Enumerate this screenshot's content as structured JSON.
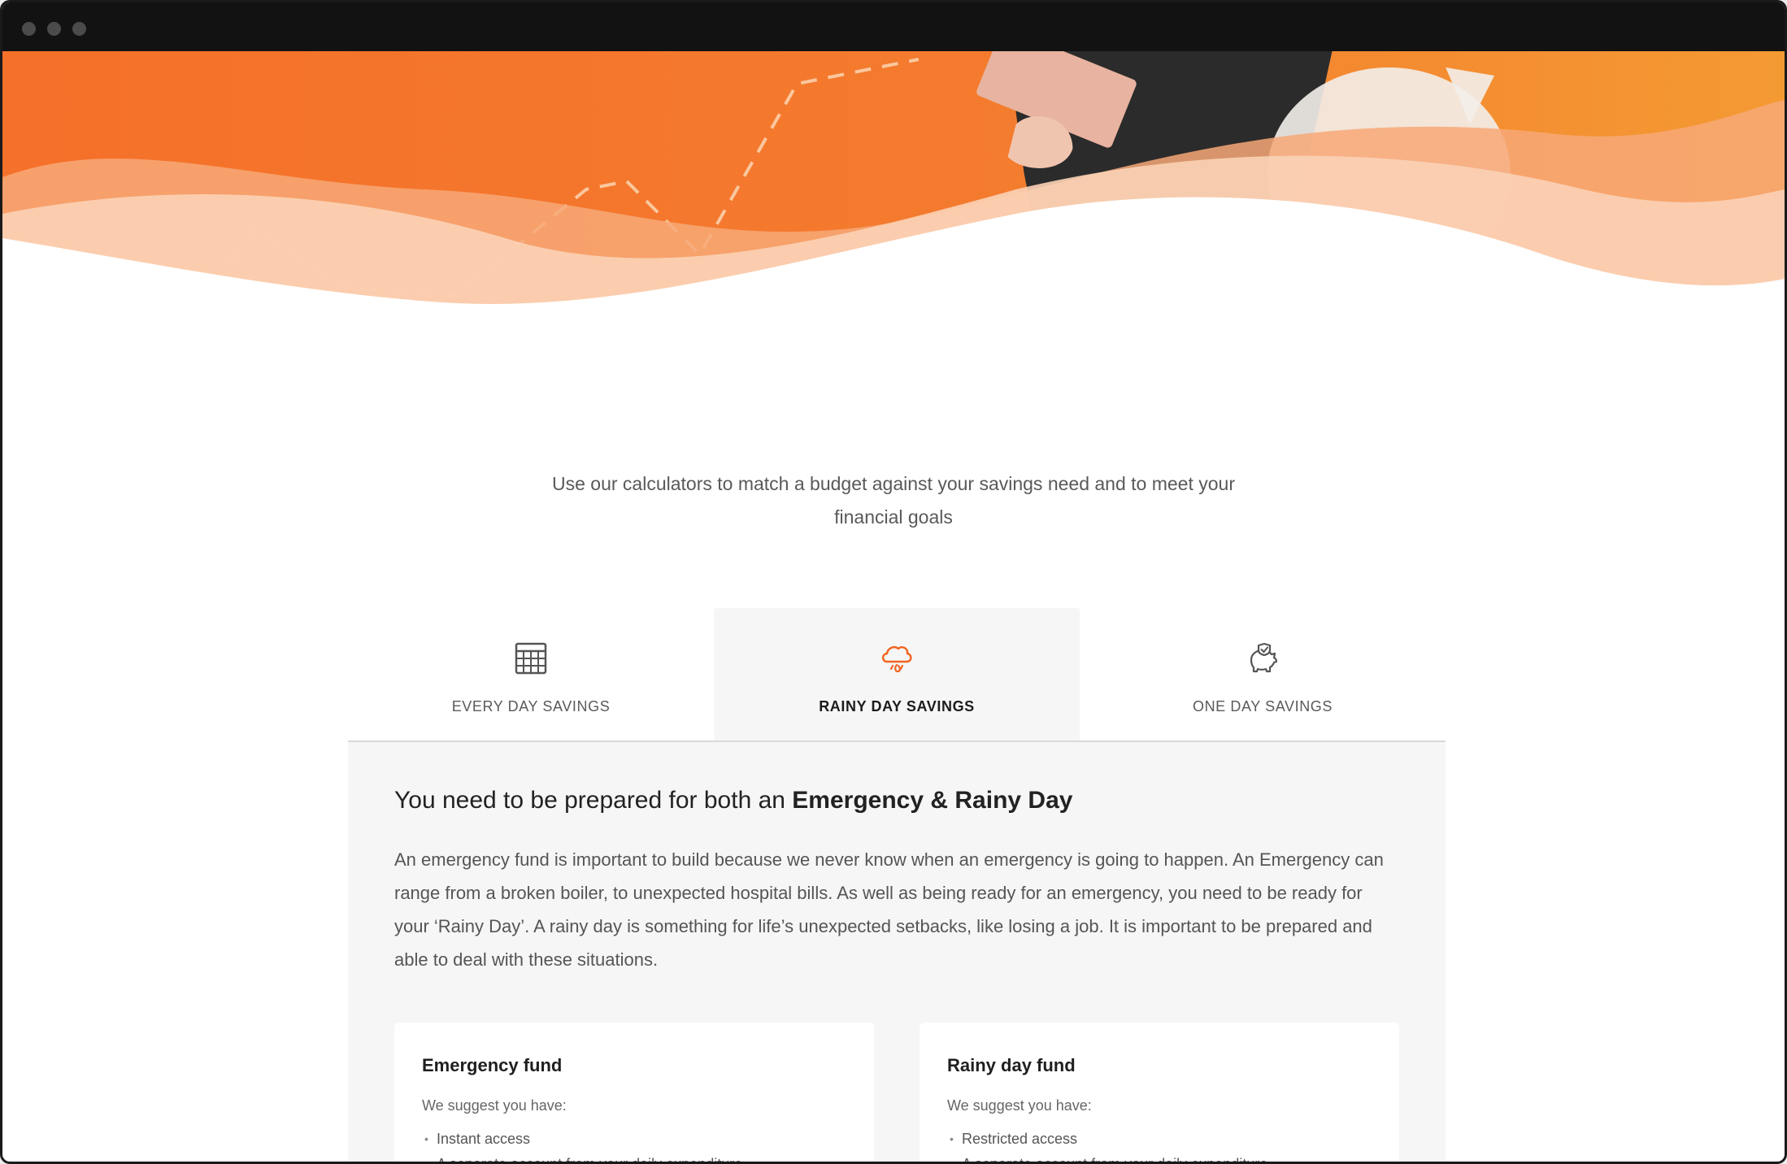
{
  "window": {
    "controls": [
      "close",
      "minimize",
      "maximize"
    ]
  },
  "intro": {
    "line1": "Use our calculators to match a budget against your savings need and to meet your",
    "line2": "financial goals"
  },
  "tabs": [
    {
      "label": "EVERY DAY SAVINGS",
      "icon": "calculator-icon",
      "active": false
    },
    {
      "label": "RAINY DAY SAVINGS",
      "icon": "rain-cloud-icon",
      "active": true
    },
    {
      "label": "ONE DAY SAVINGS",
      "icon": "piggy-bank-icon",
      "active": false
    }
  ],
  "panel": {
    "heading_prefix": "You need to be prepared for both an",
    "heading_bold": "Emergency & Rainy Day",
    "description": "An emergency fund is important to build because we never know when an emergency is going to happen. An Emergency can range from a broken boiler, to unexpected hospital bills. As well as being ready for an emergency, you need to be ready for your ‘Rainy Day’. A rainy day is something for life’s unexpected setbacks, like losing a job. It is important to be prepared and able to deal with these situations."
  },
  "cards": [
    {
      "title": "Emergency fund",
      "suggest": "We suggest you have:",
      "items": [
        "Instant access",
        "A separate account from your daily expenditure"
      ]
    },
    {
      "title": "Rainy day fund",
      "suggest": "We suggest you have:",
      "items": [
        "Restricted access",
        "A separate account from your daily expenditure"
      ]
    }
  ],
  "colors": {
    "accent": "#f26522",
    "hero_orange": "#f47a2c",
    "panel_bg": "#f6f6f6",
    "titlebar": "#121212"
  }
}
